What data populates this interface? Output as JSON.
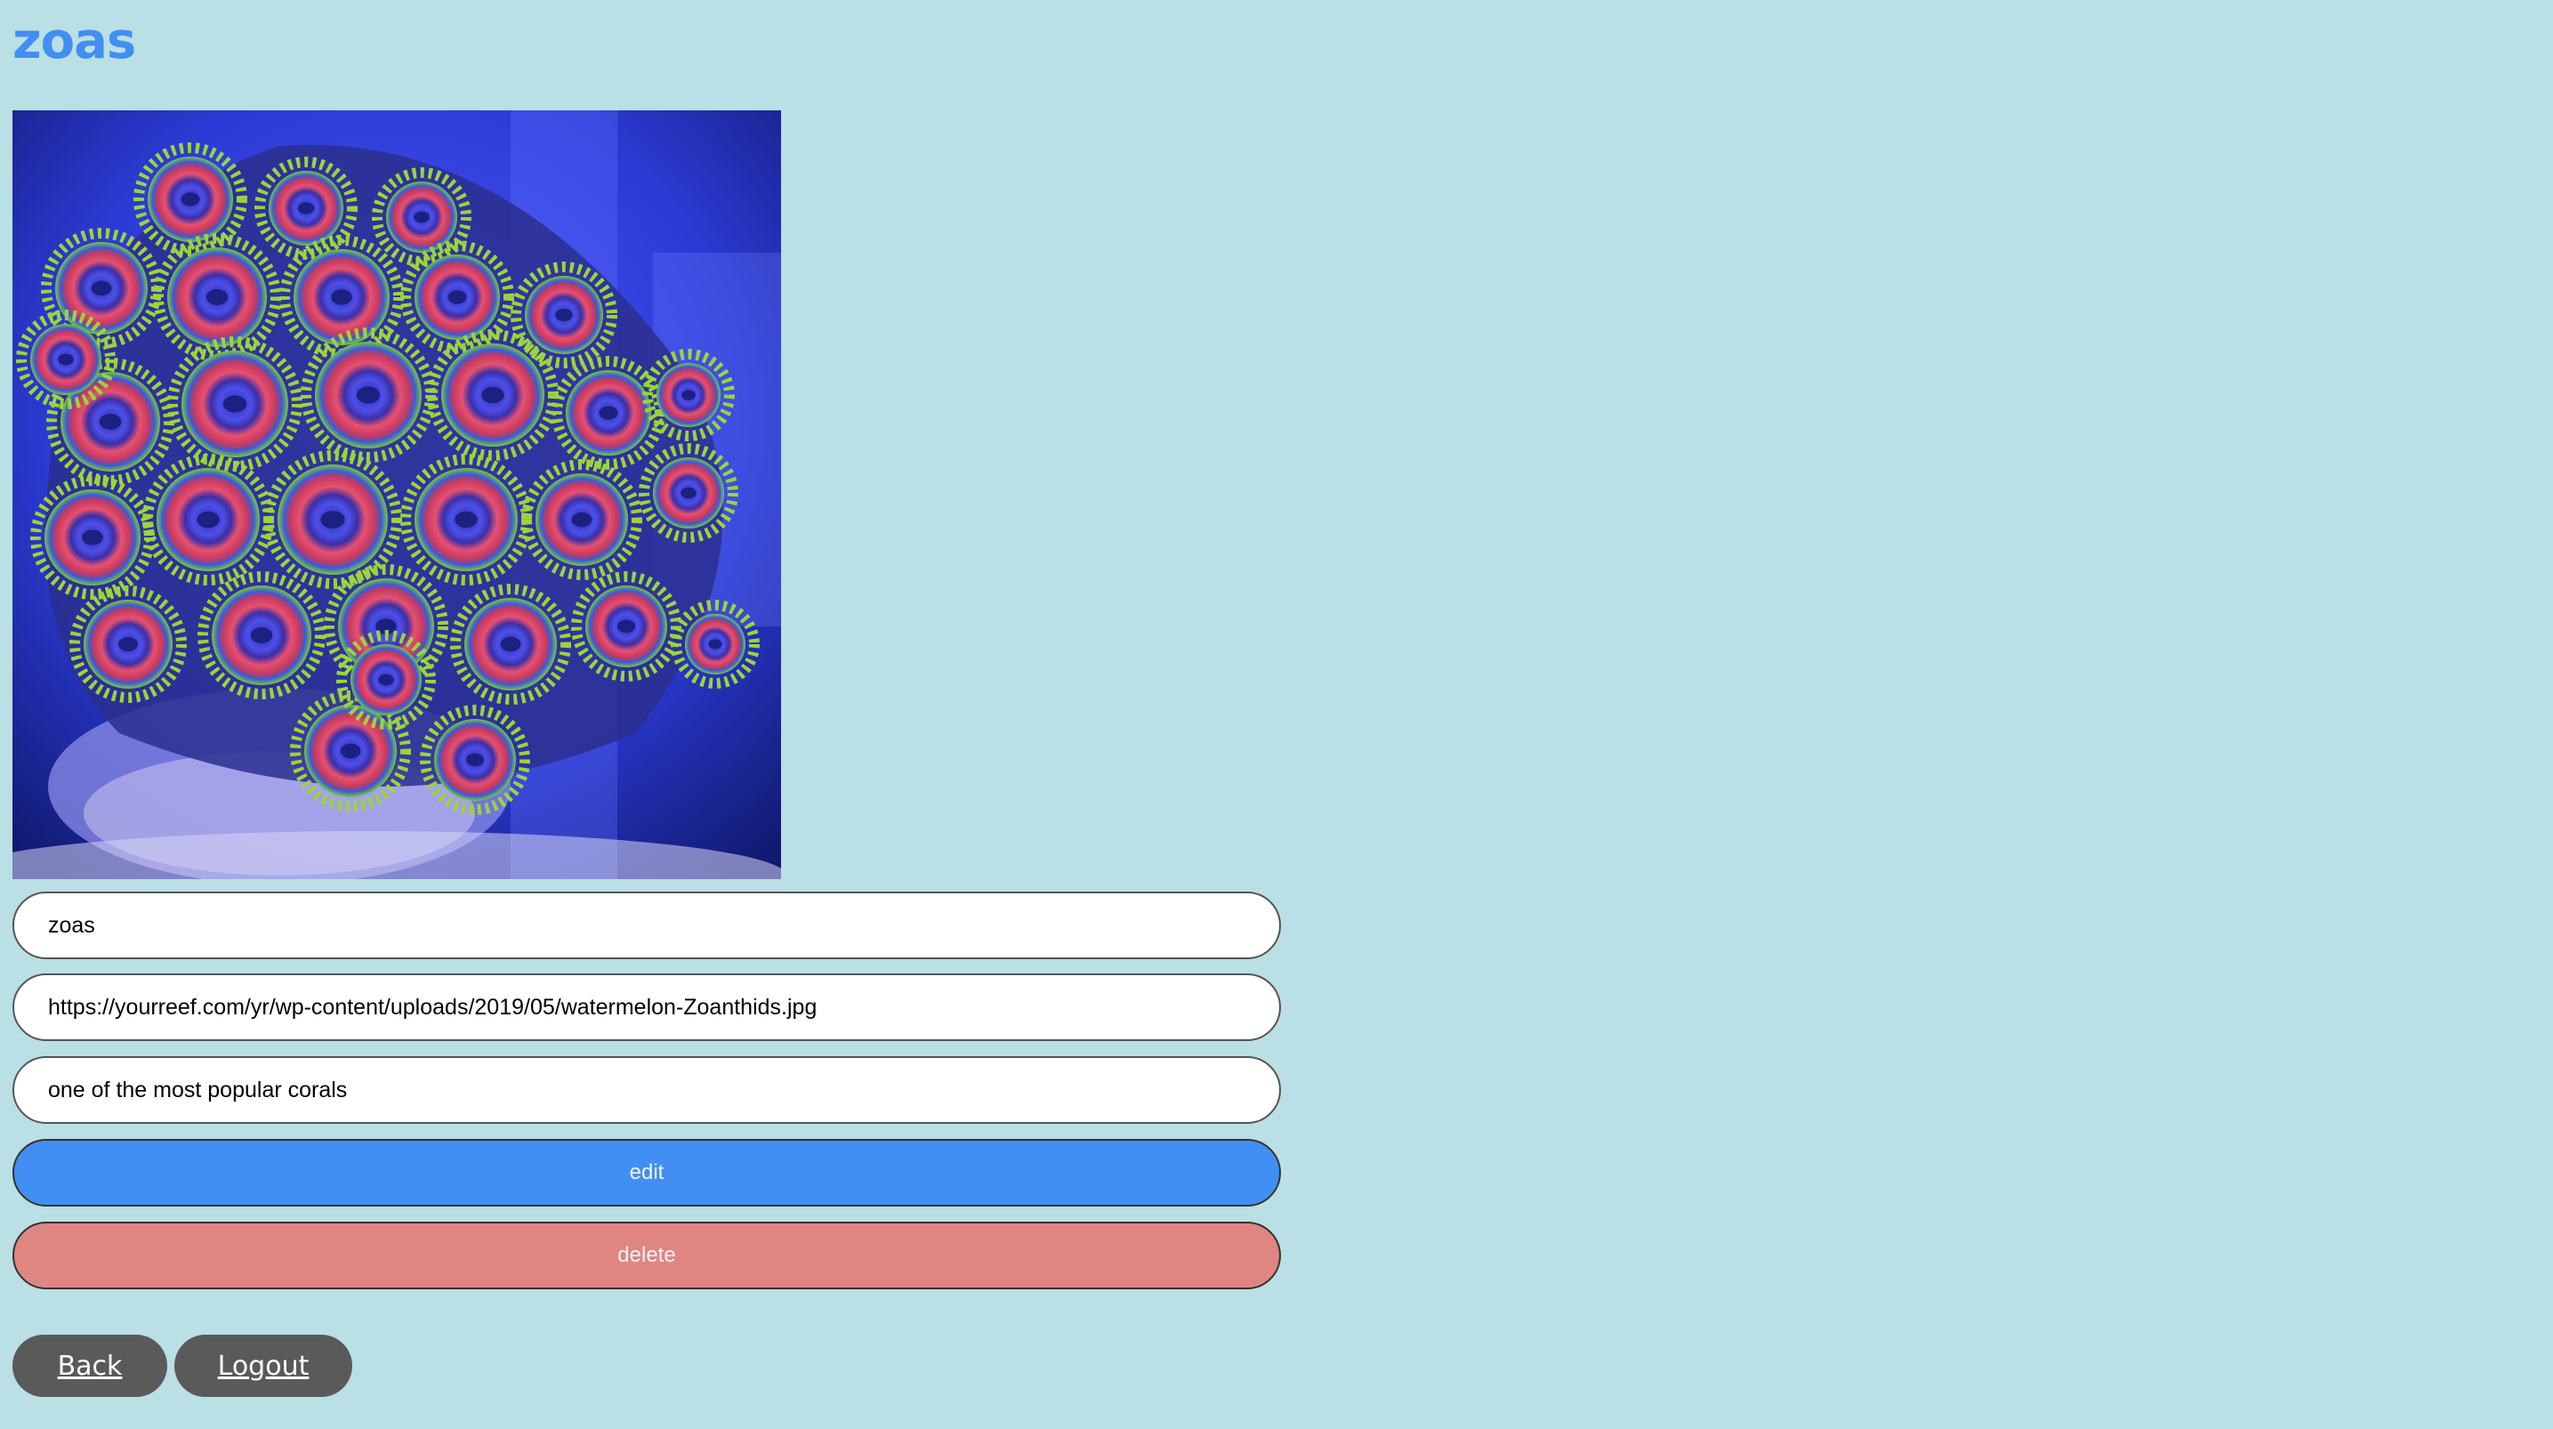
{
  "page": {
    "title": "zoas"
  },
  "image": {
    "subject": "coral-photo"
  },
  "form": {
    "name_value": "zoas",
    "url_value": "https://yourreef.com/yr/wp-content/uploads/2019/05/watermelon-Zoanthids.jpg",
    "description_value": "one of the most popular corals",
    "edit_label": "edit",
    "delete_label": "delete"
  },
  "nav": {
    "back_label": "Back",
    "logout_label": "Logout"
  },
  "colors": {
    "background": "#badfe4",
    "title": "#418ff3",
    "edit_button": "#418ff3",
    "delete_button": "#e08682",
    "nav_button": "#5a5a5a"
  }
}
